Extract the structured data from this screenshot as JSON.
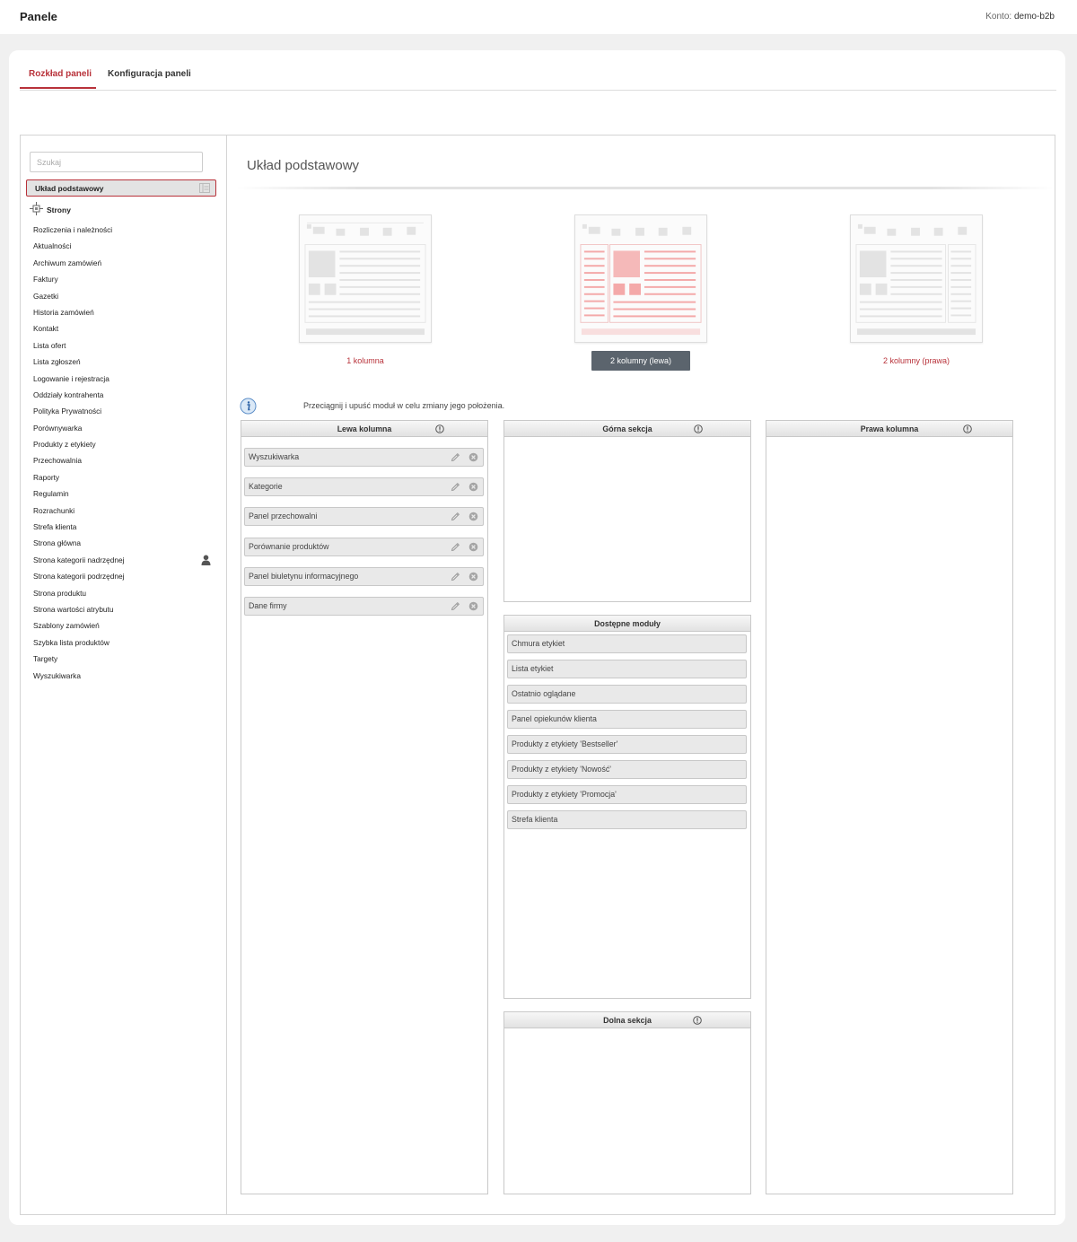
{
  "header": {
    "title": "Panele",
    "account_label": "Konto:",
    "account_value": "demo-b2b"
  },
  "tabs": [
    {
      "label": "Rozkład paneli",
      "active": true
    },
    {
      "label": "Konfiguracja paneli",
      "active": false
    }
  ],
  "sidebar": {
    "search_placeholder": "Szukaj",
    "selected": "Układ podstawowy",
    "group": "Strony",
    "items": [
      {
        "label": "Rozliczenia i należności"
      },
      {
        "label": "Aktualności"
      },
      {
        "label": "Archiwum zamówień"
      },
      {
        "label": "Faktury"
      },
      {
        "label": "Gazetki"
      },
      {
        "label": "Historia zamówień"
      },
      {
        "label": "Kontakt"
      },
      {
        "label": "Lista ofert"
      },
      {
        "label": "Lista zgłoszeń"
      },
      {
        "label": "Logowanie i rejestracja"
      },
      {
        "label": "Oddziały kontrahenta"
      },
      {
        "label": "Polityka Prywatności"
      },
      {
        "label": "Porównywarka"
      },
      {
        "label": "Produkty z etykiety"
      },
      {
        "label": "Przechowalnia"
      },
      {
        "label": "Raporty"
      },
      {
        "label": "Regulamin"
      },
      {
        "label": "Rozrachunki"
      },
      {
        "label": "Strefa klienta"
      },
      {
        "label": "Strona główna"
      },
      {
        "label": "Strona kategorii nadrzędnej",
        "icon": "user-icon"
      },
      {
        "label": "Strona kategorii podrzędnej"
      },
      {
        "label": "Strona produktu"
      },
      {
        "label": "Strona wartości atrybutu"
      },
      {
        "label": "Szablony zamówień"
      },
      {
        "label": "Szybka lista produktów"
      },
      {
        "label": "Targety"
      },
      {
        "label": "Wyszukiwarka"
      }
    ]
  },
  "main": {
    "title": "Układ podstawowy",
    "layouts": [
      {
        "label": "1 kolumna",
        "active": false
      },
      {
        "label": "2 kolumny (lewa)",
        "active": true
      },
      {
        "label": "2 kolumny (prawa)",
        "active": false
      }
    ],
    "info_text": "Przeciągnij i upuść moduł w celu zmiany jego położenia.",
    "panels": {
      "left": {
        "title": "Lewa kolumna",
        "modules": [
          "Wyszukiwarka",
          "Kategorie",
          "Panel przechowalni",
          "Porównanie produktów",
          "Panel biuletynu informacyjnego",
          "Dane firmy"
        ]
      },
      "top": {
        "title": "Górna sekcja"
      },
      "available": {
        "title": "Dostępne moduły",
        "modules": [
          "Chmura etykiet",
          "Lista etykiet",
          "Ostatnio oglądane",
          "Panel opiekunów klienta",
          "Produkty z etykiety 'Bestseller'",
          "Produkty z etykiety 'Nowość'",
          "Produkty z etykiety 'Promocja'",
          "Strefa klienta"
        ]
      },
      "bottom": {
        "title": "Dolna sekcja"
      },
      "right": {
        "title": "Prawa kolumna"
      }
    }
  },
  "colors": {
    "accent": "#b8323a",
    "active_button": "#5b646d",
    "highlight": "#f4a9a9"
  }
}
